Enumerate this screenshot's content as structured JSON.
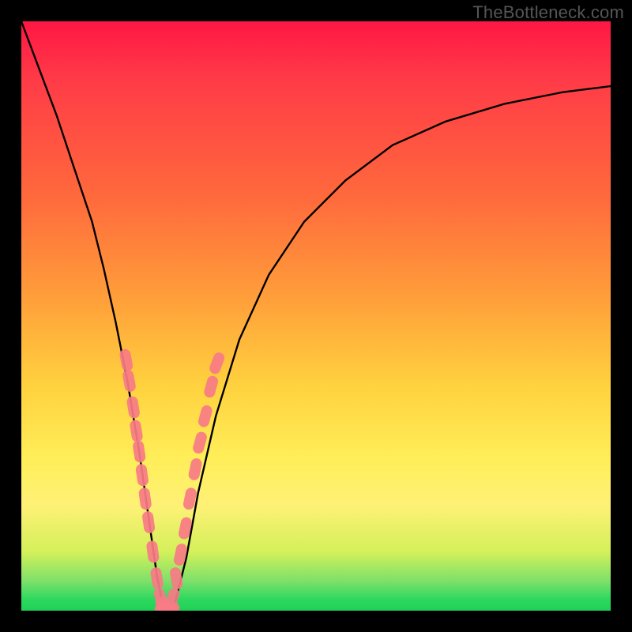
{
  "watermark": "TheBottleneck.com",
  "chart_data": {
    "type": "line",
    "title": "",
    "xlabel": "",
    "ylabel": "",
    "xlim": [
      0,
      100
    ],
    "ylim": [
      0,
      100
    ],
    "series": [
      {
        "name": "bottleneck-curve",
        "x": [
          0,
          3,
          6,
          9,
          12,
          14,
          16,
          18,
          19,
          20,
          21,
          22,
          23,
          24,
          25,
          26,
          28,
          30,
          33,
          37,
          42,
          48,
          55,
          63,
          72,
          82,
          92,
          100
        ],
        "values": [
          100,
          92,
          84,
          75,
          66,
          58,
          49,
          39,
          33,
          27,
          20,
          13,
          6,
          1,
          0,
          1,
          9,
          20,
          33,
          46,
          57,
          66,
          73,
          79,
          83,
          86,
          88,
          89
        ]
      }
    ],
    "markers": [
      {
        "x": 17.8,
        "y": 42.5
      },
      {
        "x": 18.3,
        "y": 39.0
      },
      {
        "x": 19.0,
        "y": 34.5
      },
      {
        "x": 19.5,
        "y": 30.5
      },
      {
        "x": 20.0,
        "y": 27.0
      },
      {
        "x": 20.5,
        "y": 23.0
      },
      {
        "x": 21.0,
        "y": 19.0
      },
      {
        "x": 21.6,
        "y": 15.0
      },
      {
        "x": 22.3,
        "y": 10.0
      },
      {
        "x": 23.0,
        "y": 5.5
      },
      {
        "x": 23.7,
        "y": 2.0
      },
      {
        "x": 24.0,
        "y": 0.5
      },
      {
        "x": 24.5,
        "y": 0.3
      },
      {
        "x": 25.0,
        "y": 0.5
      },
      {
        "x": 25.6,
        "y": 2.0
      },
      {
        "x": 26.3,
        "y": 5.5
      },
      {
        "x": 27.0,
        "y": 9.5
      },
      {
        "x": 27.8,
        "y": 14.0
      },
      {
        "x": 28.6,
        "y": 19.0
      },
      {
        "x": 29.5,
        "y": 24.0
      },
      {
        "x": 30.3,
        "y": 28.5
      },
      {
        "x": 31.2,
        "y": 33.0
      },
      {
        "x": 32.2,
        "y": 38.0
      },
      {
        "x": 33.2,
        "y": 42.0
      }
    ],
    "colors": {
      "curve": "#000000",
      "markers": "#f77b86"
    }
  }
}
